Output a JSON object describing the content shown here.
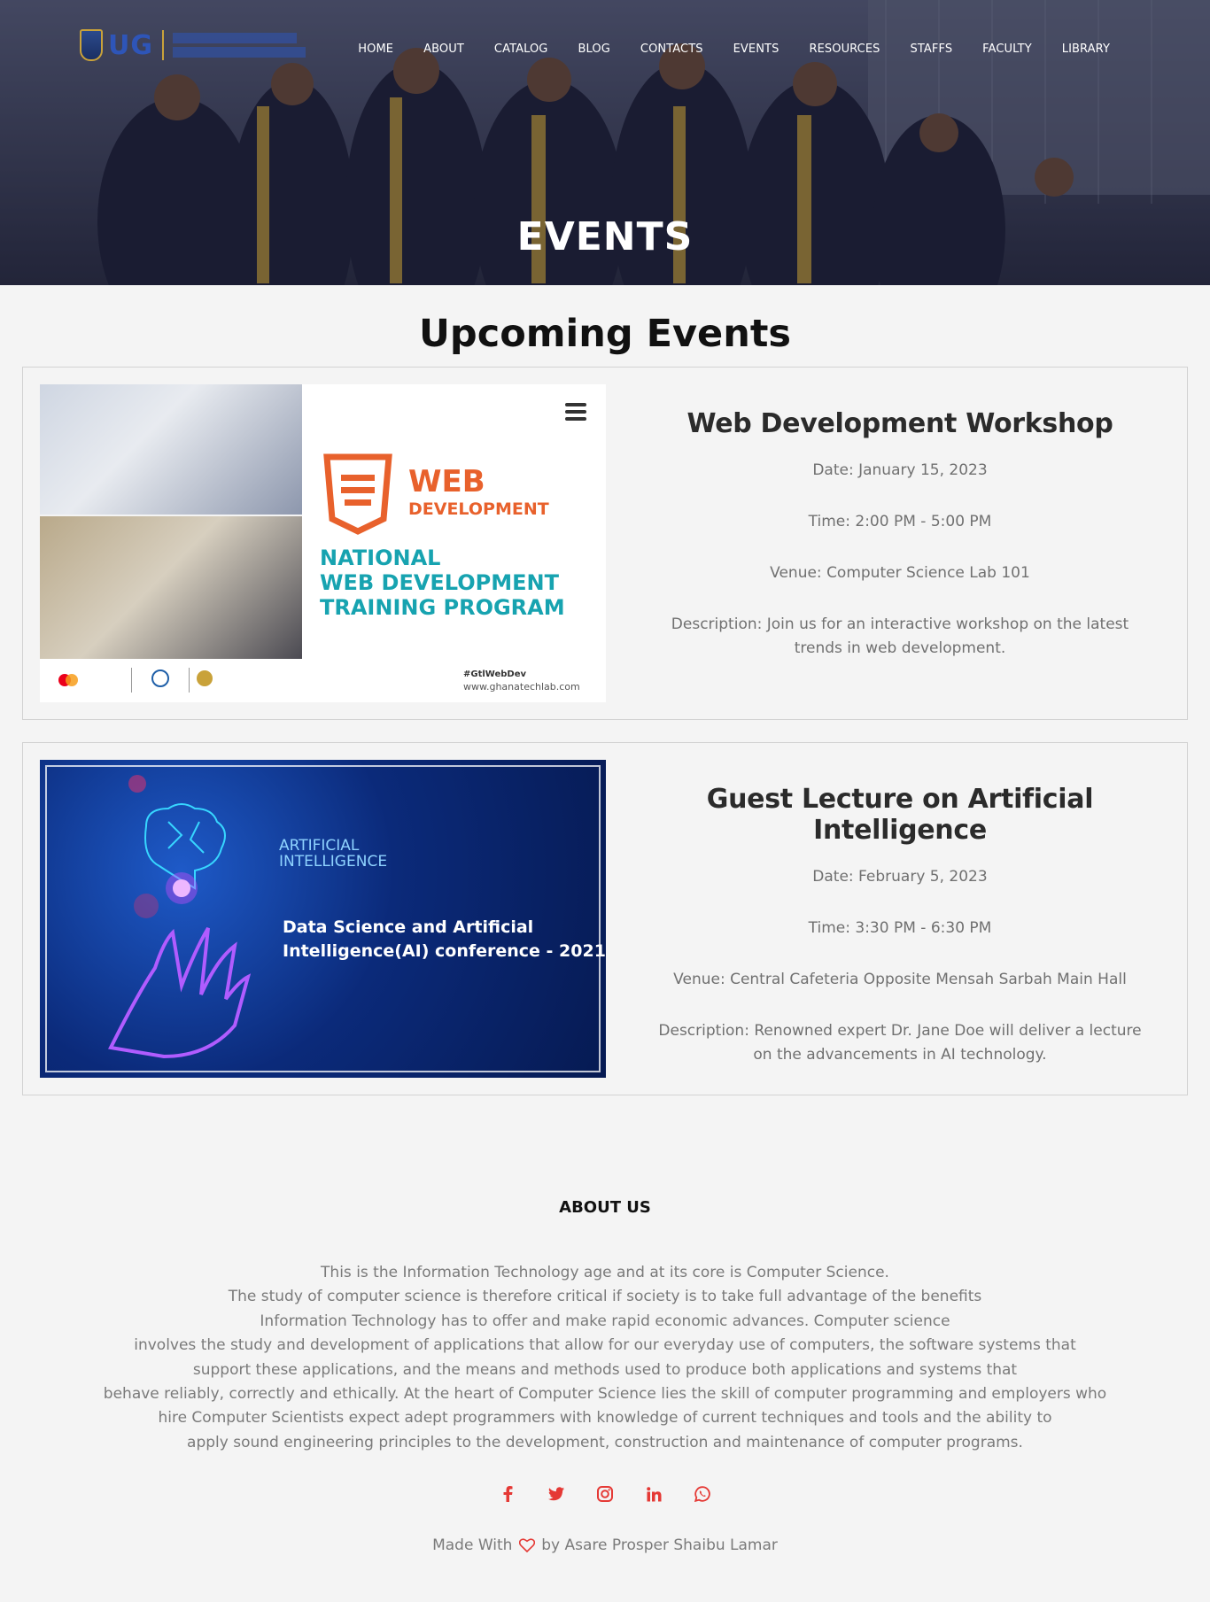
{
  "header": {
    "logo_text": "UG",
    "nav": [
      {
        "label": "HOME"
      },
      {
        "label": "ABOUT"
      },
      {
        "label": "CATALOG"
      },
      {
        "label": "BLOG"
      },
      {
        "label": "CONTACTS"
      },
      {
        "label": "EVENTS"
      },
      {
        "label": "RESOURCES"
      },
      {
        "label": "STAFFS"
      },
      {
        "label": "FACULTY"
      },
      {
        "label": "LIBRARY"
      }
    ],
    "page_title": "EVENTS"
  },
  "upcoming": {
    "title": "Upcoming Events",
    "events": [
      {
        "title": "Web Development Workshop",
        "date": "Date: January 15, 2023",
        "time": "Time: 2:00 PM - 5:00 PM",
        "venue": "Venue: Computer Science Lab 101",
        "description": "Description: Join us for an interactive workshop on the latest trends in web development.",
        "image_text": {
          "web": "WEB",
          "development": "DEVELOPMENT",
          "program_l1": "NATIONAL",
          "program_l2": "WEB DEVELOPMENT",
          "program_l3": "TRAINING PROGRAM",
          "hashtag": "#GtlWebDev",
          "url": "www.ghanatechlab.com"
        }
      },
      {
        "title": "Guest Lecture on Artificial Intelligence",
        "date": "Date: February 5, 2023",
        "time": "Time: 3:30 PM - 6:30 PM",
        "venue": "Venue: Central Cafeteria Opposite Mensah Sarbah Main Hall",
        "description": "Description: Renowned expert Dr. Jane Doe will deliver a lecture on the advancements in AI technology.",
        "image_text": {
          "ai_l1": "ARTIFICIAL",
          "ai_l2": "INTELLIGENCE",
          "conf_l1": "Data Science and Artificial",
          "conf_l2": "Intelligence(AI) conference - 2021"
        }
      }
    ]
  },
  "about": {
    "title": "ABOUT US",
    "lines": [
      "This is the Information Technology age and at its core is Computer Science.",
      "The study of computer science is therefore critical if society is to take full advantage of the benefits",
      "Information Technology has to offer and make rapid economic advances. Computer science",
      "involves the study and development of applications that allow for our everyday use of computers, the software systems that",
      "support these applications, and the means and methods used to produce both applications and systems that",
      "behave reliably, correctly and ethically. At the heart of Computer Science lies the skill of computer programming and employers who",
      "hire Computer Scientists expect adept programmers with knowledge of current techniques and tools and the ability to",
      "apply sound engineering principles to the development, construction and maintenance of computer programs."
    ]
  },
  "footer": {
    "social_icons": [
      "facebook-icon",
      "twitter-icon",
      "instagram-icon",
      "linkedin-icon",
      "whatsapp-icon"
    ],
    "credit_prefix": "Made With",
    "credit_suffix": "by Asare Prosper Shaibu Lamar"
  },
  "colors": {
    "accent_red": "#e53935",
    "page_bg": "#f4f4f4"
  }
}
